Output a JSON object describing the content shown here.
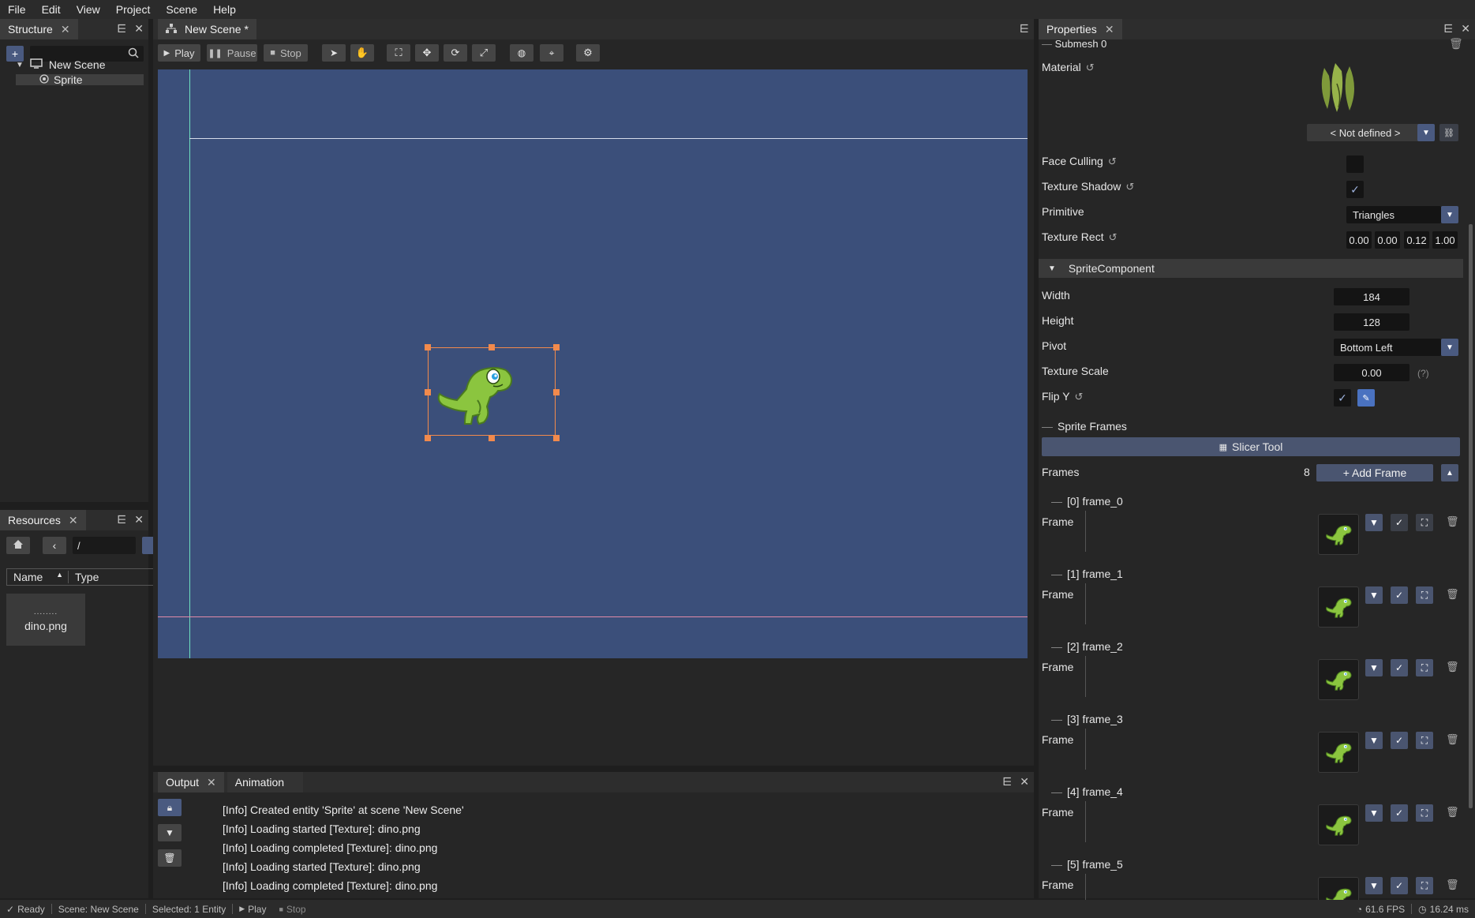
{
  "menu": [
    "File",
    "Edit",
    "View",
    "Project",
    "Scene",
    "Help"
  ],
  "structure": {
    "tab_label": "Structure",
    "add_label": "+",
    "tree": [
      {
        "label": "New Scene",
        "icon": "monitor-icon"
      },
      {
        "label": "Sprite",
        "icon": "sprite-icon"
      }
    ]
  },
  "resources": {
    "tab_label": "Resources",
    "path": "/",
    "columns": [
      "Name",
      "Type"
    ],
    "sort_indicator": "▲",
    "items": [
      {
        "name": "dino.png",
        "thumb_text": "........"
      }
    ]
  },
  "scene": {
    "tab_label": "New Scene *",
    "toolbar": {
      "play": "Play",
      "pause": "Pause",
      "stop": "Stop"
    }
  },
  "output": {
    "tabs": [
      "Output",
      "Animation"
    ],
    "lines": [
      "[Info] Created entity 'Sprite' at scene 'New Scene'",
      "[Info] Loading started [Texture]: dino.png",
      "[Info] Loading completed [Texture]: dino.png",
      "[Info] Loading started [Texture]: dino.png",
      "[Info] Loading completed [Texture]: dino.png"
    ]
  },
  "properties": {
    "tab_label": "Properties",
    "submesh_label": "Submesh 0",
    "material_label": "Material",
    "material_value": "< Not defined >",
    "face_culling_label": "Face Culling",
    "texture_shadow_label": "Texture Shadow",
    "primitive_label": "Primitive",
    "primitive_value": "Triangles",
    "texture_rect_label": "Texture Rect",
    "texture_rect": [
      "0.00",
      "0.00",
      "0.12",
      "1.00"
    ],
    "sprite_component_label": "SpriteComponent",
    "width_label": "Width",
    "width_value": "184",
    "height_label": "Height",
    "height_value": "128",
    "pivot_label": "Pivot",
    "pivot_value": "Bottom Left",
    "texture_scale_label": "Texture Scale",
    "texture_scale_value": "0.00",
    "texture_scale_hint": "(?)",
    "flip_y_label": "Flip Y",
    "sprite_frames_label": "Sprite Frames",
    "slicer_tool_label": "Slicer Tool",
    "frames_label": "Frames",
    "frames_count": "8",
    "add_frame_label": "+ Add Frame",
    "frame_field_label": "Frame",
    "frames": [
      "[0] frame_0",
      "[1] frame_1",
      "[2] frame_2",
      "[3] frame_3",
      "[4] frame_4",
      "[5] frame_5"
    ]
  },
  "status": {
    "ready": "Ready",
    "scene": "Scene: New Scene",
    "selected": "Selected: 1 Entity",
    "play": "Play",
    "stop": "Stop",
    "fps": "61.6 FPS",
    "ms": "16.24 ms"
  },
  "colors": {
    "viewport_bg": "#3b4f7a",
    "accent": "#4a5a80",
    "selection": "#f28a4c"
  }
}
